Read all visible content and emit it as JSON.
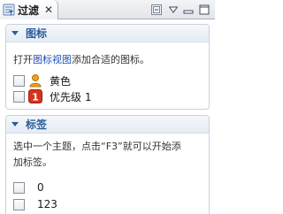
{
  "tab": {
    "label": "过滤",
    "close": "✕",
    "icon": "filter-icon"
  },
  "toolbar": {
    "icons": [
      "collapse-all-icon",
      "view-menu-icon",
      "minimize-icon",
      "maximize-icon"
    ]
  },
  "sections": {
    "icons": {
      "title": "图标",
      "desc_before": "打开",
      "desc_link": "图标视图",
      "desc_after": "添加合适的图标。",
      "items": [
        {
          "label": "黄色",
          "icon": "person-icon",
          "checked": false
        },
        {
          "label": "优先级 1",
          "icon": "priority-1-icon",
          "badge": "1",
          "checked": false
        }
      ]
    },
    "tags": {
      "title": "标签",
      "desc_line1": "选中一个主题，点击“F3”就可以开始添",
      "desc_line2": "加标签。",
      "items": [
        {
          "label": "0",
          "checked": false
        },
        {
          "label": "123",
          "checked": false
        }
      ]
    }
  },
  "colors": {
    "accent": "#2a5d9a",
    "link": "#1f4fb8",
    "priority_badge": "#d8321f",
    "person": "#f0a020"
  }
}
